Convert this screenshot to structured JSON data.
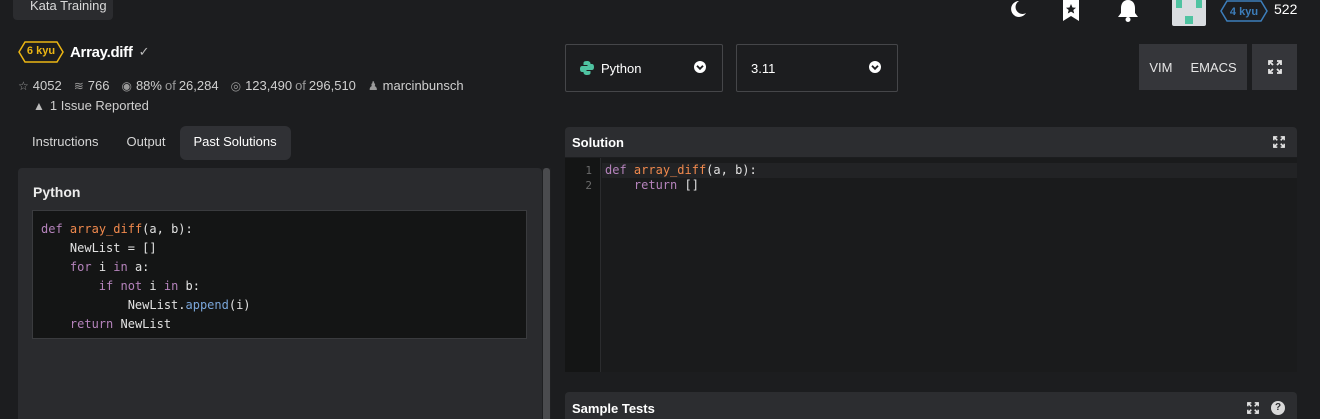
{
  "topbar": {
    "tooltip": "Kata Training",
    "icons": [
      "moon-icon",
      "bookmark-star-icon",
      "bell-icon"
    ],
    "user_rank": "4 kyu",
    "honor": "522",
    "rank_color": "#3c7ebb"
  },
  "kata": {
    "rank": "6 kyu",
    "rank_color": "#ecb613",
    "title": "Array.diff",
    "stats": {
      "stars": "4052",
      "collections": "766",
      "satisfaction": "88%",
      "satisfaction_of": "of",
      "satisfaction_votes": "26,284",
      "completed": "123,490",
      "completed_of": "of",
      "attempted": "296,510",
      "author": "marcinbunsch"
    },
    "issues": "1 Issue Reported"
  },
  "tabs": [
    {
      "label": "Instructions"
    },
    {
      "label": "Output"
    },
    {
      "label": "Past Solutions",
      "active": true
    }
  ],
  "past_solution": {
    "language": "Python",
    "code_lines": [
      "def array_diff(a, b):",
      "    NewList = []",
      "    for i in a:",
      "        if not i in b:",
      "            NewList.append(i)",
      "    return NewList"
    ]
  },
  "editor_toolbar": {
    "language": "Python",
    "version": "3.11",
    "vim_label": "VIM",
    "emacs_label": "EMACS"
  },
  "solution": {
    "title": "Solution",
    "line_numbers": [
      "1",
      "2"
    ],
    "code_lines": [
      "def array_diff(a, b):",
      "    return []"
    ]
  },
  "sample_tests": {
    "title": "Sample Tests",
    "help": "?"
  }
}
